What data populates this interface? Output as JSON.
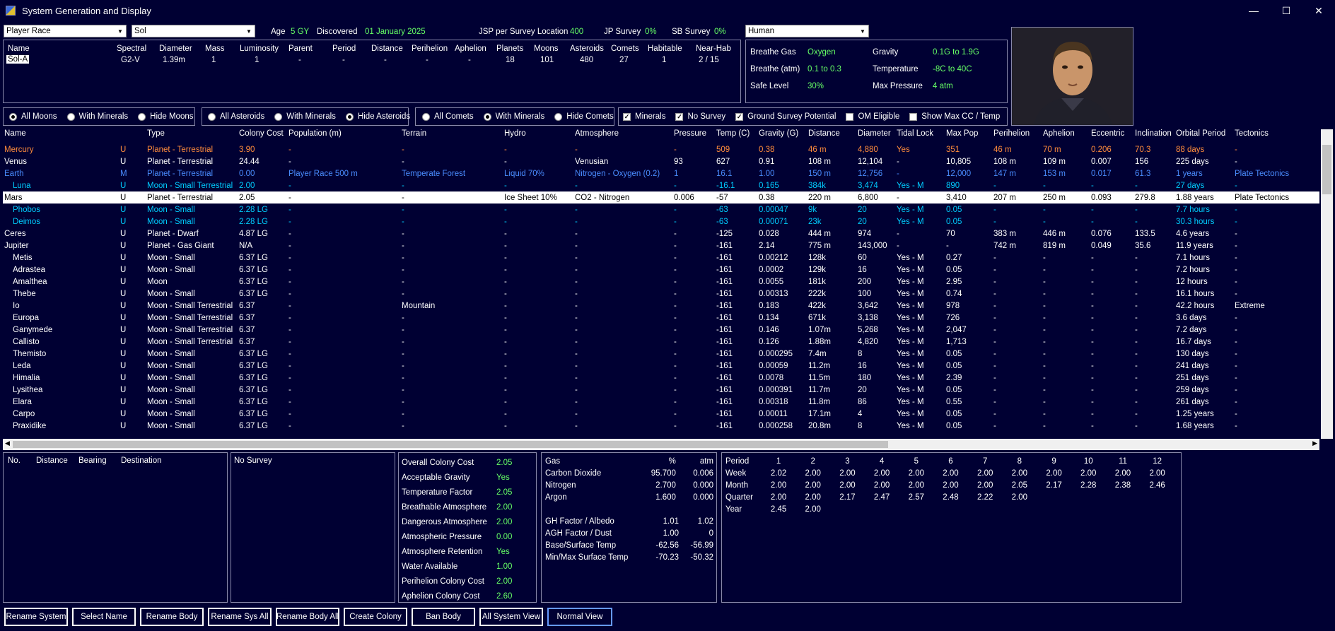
{
  "window": {
    "title": "System Generation and Display",
    "minimize": "—",
    "maximize": "☐",
    "close": "✕"
  },
  "top": {
    "race_combo": "Player Race",
    "system_combo": "Sol",
    "age_label": "Age",
    "age_value": "5 GY",
    "discovered_label": "Discovered",
    "discovered_value": "01 January 2025",
    "jsp_label": "JSP per Survey Location",
    "jsp_value": "400",
    "jp_label": "JP Survey",
    "jp_value": "0%",
    "sb_label": "SB Survey",
    "sb_value": "0%",
    "species_combo": "Human"
  },
  "star_panel": {
    "headers": [
      "Name",
      "Spectral",
      "Diameter",
      "Mass",
      "Luminosity",
      "Parent",
      "Period",
      "Distance",
      "Perihelion",
      "Aphelion",
      "Planets",
      "Moons",
      "Asteroids",
      "Comets",
      "Habitable",
      "Near-Hab"
    ],
    "row": [
      "Sol-A",
      "G2-V",
      "1.39m",
      "1",
      "1",
      "-",
      "-",
      "-",
      "-",
      "-",
      "18",
      "101",
      "480",
      "27",
      "1",
      "2 / 15"
    ]
  },
  "env_panel": {
    "breathe_gas_label": "Breathe Gas",
    "breathe_gas_value": "Oxygen",
    "gravity_label": "Gravity",
    "gravity_value": "0.1G  to  1.9G",
    "breathe_atm_label": "Breathe (atm)",
    "breathe_atm_value": "0.1  to  0.3",
    "temperature_label": "Temperature",
    "temperature_value": "-8C  to  40C",
    "safe_level_label": "Safe Level",
    "safe_level_value": "30%",
    "max_pressure_label": "Max Pressure",
    "max_pressure_value": "4 atm"
  },
  "filters": {
    "moons": {
      "all": "All Moons",
      "minerals": "With Minerals",
      "hide": "Hide Moons"
    },
    "asteroids": {
      "all": "All Asteroids",
      "minerals": "With Minerals",
      "hide": "Hide Asteroids"
    },
    "comets": {
      "all": "All Comets",
      "minerals": "With Minerals",
      "hide": "Hide Comets"
    },
    "checks": {
      "minerals": "Minerals",
      "no_survey": "No Survey",
      "ground_survey": "Ground Survey Potential",
      "om_eligible": "OM Eligible",
      "show_max_cc": "Show Max CC / Temp"
    }
  },
  "grid": {
    "columns": [
      "Name",
      "",
      "Type",
      "Colony Cost",
      "Population (m)",
      "Terrain",
      "Hydro",
      "Atmosphere",
      "Pressure",
      "Temp (C)",
      "Gravity (G)",
      "Distance",
      "Diameter",
      "Tidal Lock",
      "Max Pop",
      "Perihelion",
      "Aphelion",
      "Eccentric",
      "Inclination",
      "Orbital Period",
      "Tectonics"
    ],
    "rows": [
      {
        "c": [
          "Mercury",
          "U",
          "Planet - Terrestrial",
          "3.90",
          "-",
          "-",
          "-",
          "-",
          "-",
          "509",
          "0.38",
          "46 m",
          "4,880",
          "Yes",
          "351",
          "46 m",
          "70 m",
          "0.206",
          "70.3",
          "88 days",
          "-"
        ],
        "color": "#ff8c3c"
      },
      {
        "c": [
          "Venus",
          "U",
          "Planet - Terrestrial",
          "24.44",
          "-",
          "-",
          "-",
          "Venusian",
          "93",
          "627",
          "0.91",
          "108 m",
          "12,104",
          "-",
          "10,805",
          "108 m",
          "109 m",
          "0.007",
          "156",
          "225 days",
          "-"
        ],
        "color": "#ffffff"
      },
      {
        "c": [
          "Earth",
          "M",
          "Planet - Terrestrial",
          "0.00",
          "Player Race 500 m",
          "Temperate Forest",
          "Liquid 70%",
          "Nitrogen - Oxygen (0.2)",
          "1",
          "16.1",
          "1.00",
          "150 m",
          "12,756",
          "-",
          "12,000",
          "147 m",
          "153 m",
          "0.017",
          "61.3",
          "1 years",
          "Plate Tectonics"
        ],
        "color": "#4a8cff"
      },
      {
        "c": [
          "Luna",
          "U",
          "Moon - Small Terrestrial",
          "2.00",
          "-",
          "-",
          "-",
          "-",
          "-",
          "-16.1",
          "0.165",
          "384k",
          "3,474",
          "Yes - M",
          "890",
          "-",
          "-",
          "-",
          "-",
          "27 days",
          "-"
        ],
        "color": "#00ccff",
        "indent": true
      },
      {
        "c": [
          "Mars",
          "U",
          "Planet - Terrestrial",
          "2.05",
          "-",
          "-",
          "Ice Sheet 10%",
          "CO2 - Nitrogen",
          "0.006",
          "-57",
          "0.38",
          "220 m",
          "6,800",
          "-",
          "3,410",
          "207 m",
          "250 m",
          "0.093",
          "279.8",
          "1.88 years",
          "Plate Tectonics"
        ],
        "color": "#000000",
        "selected": true
      },
      {
        "c": [
          "Phobos",
          "U",
          "Moon - Small",
          "2.28 LG",
          "-",
          "-",
          "-",
          "-",
          "-",
          "-63",
          "0.00047",
          "9k",
          "20",
          "Yes - M",
          "0.05",
          "-",
          "-",
          "-",
          "-",
          "7.7 hours",
          "-"
        ],
        "color": "#00ccff",
        "indent": true
      },
      {
        "c": [
          "Deimos",
          "U",
          "Moon - Small",
          "2.28 LG",
          "-",
          "-",
          "-",
          "-",
          "-",
          "-63",
          "0.00071",
          "23k",
          "20",
          "Yes - M",
          "0.05",
          "-",
          "-",
          "-",
          "-",
          "30.3 hours",
          "-"
        ],
        "color": "#00ccff",
        "indent": true
      },
      {
        "c": [
          "Ceres",
          "U",
          "Planet - Dwarf",
          "4.87 LG",
          "-",
          "-",
          "-",
          "-",
          "-",
          "-125",
          "0.028",
          "444 m",
          "974",
          "-",
          "70",
          "383 m",
          "446 m",
          "0.076",
          "133.5",
          "4.6 years",
          "-"
        ],
        "color": "#ffffff"
      },
      {
        "c": [
          "Jupiter",
          "U",
          "Planet - Gas Giant",
          "N/A",
          "-",
          "-",
          "-",
          "-",
          "-",
          "-161",
          "2.14",
          "775 m",
          "143,000",
          "-",
          "-",
          "742 m",
          "819 m",
          "0.049",
          "35.6",
          "11.9 years",
          "-"
        ],
        "color": "#ffffff"
      },
      {
        "c": [
          "Metis",
          "U",
          "Moon - Small",
          "6.37 LG",
          "-",
          "-",
          "-",
          "-",
          "-",
          "-161",
          "0.00212",
          "128k",
          "60",
          "Yes - M",
          "0.27",
          "-",
          "-",
          "-",
          "-",
          "7.1 hours",
          "-"
        ],
        "color": "#ffffff",
        "indent": true
      },
      {
        "c": [
          "Adrastea",
          "U",
          "Moon - Small",
          "6.37 LG",
          "-",
          "-",
          "-",
          "-",
          "-",
          "-161",
          "0.0002",
          "129k",
          "16",
          "Yes - M",
          "0.05",
          "-",
          "-",
          "-",
          "-",
          "7.2 hours",
          "-"
        ],
        "color": "#ffffff",
        "indent": true
      },
      {
        "c": [
          "Amalthea",
          "U",
          "Moon",
          "6.37 LG",
          "-",
          "-",
          "-",
          "-",
          "-",
          "-161",
          "0.0055",
          "181k",
          "200",
          "Yes - M",
          "2.95",
          "-",
          "-",
          "-",
          "-",
          "12 hours",
          "-"
        ],
        "color": "#ffffff",
        "indent": true
      },
      {
        "c": [
          "Thebe",
          "U",
          "Moon - Small",
          "6.37 LG",
          "-",
          "-",
          "-",
          "-",
          "-",
          "-161",
          "0.00313",
          "222k",
          "100",
          "Yes - M",
          "0.74",
          "-",
          "-",
          "-",
          "-",
          "16.1 hours",
          "-"
        ],
        "color": "#ffffff",
        "indent": true
      },
      {
        "c": [
          "Io",
          "U",
          "Moon - Small Terrestrial",
          "6.37",
          "-",
          "Mountain",
          "-",
          "-",
          "-",
          "-161",
          "0.183",
          "422k",
          "3,642",
          "Yes - M",
          "978",
          "-",
          "-",
          "-",
          "-",
          "42.2 hours",
          "Extreme"
        ],
        "color": "#ffffff",
        "indent": true
      },
      {
        "c": [
          "Europa",
          "U",
          "Moon - Small Terrestrial",
          "6.37",
          "-",
          "-",
          "-",
          "-",
          "-",
          "-161",
          "0.134",
          "671k",
          "3,138",
          "Yes - M",
          "726",
          "-",
          "-",
          "-",
          "-",
          "3.6 days",
          "-"
        ],
        "color": "#ffffff",
        "indent": true
      },
      {
        "c": [
          "Ganymede",
          "U",
          "Moon - Small Terrestrial",
          "6.37",
          "-",
          "-",
          "-",
          "-",
          "-",
          "-161",
          "0.146",
          "1.07m",
          "5,268",
          "Yes - M",
          "2,047",
          "-",
          "-",
          "-",
          "-",
          "7.2 days",
          "-"
        ],
        "color": "#ffffff",
        "indent": true
      },
      {
        "c": [
          "Callisto",
          "U",
          "Moon - Small Terrestrial",
          "6.37",
          "-",
          "-",
          "-",
          "-",
          "-",
          "-161",
          "0.126",
          "1.88m",
          "4,820",
          "Yes - M",
          "1,713",
          "-",
          "-",
          "-",
          "-",
          "16.7 days",
          "-"
        ],
        "color": "#ffffff",
        "indent": true
      },
      {
        "c": [
          "Themisto",
          "U",
          "Moon - Small",
          "6.37 LG",
          "-",
          "-",
          "-",
          "-",
          "-",
          "-161",
          "0.000295",
          "7.4m",
          "8",
          "Yes - M",
          "0.05",
          "-",
          "-",
          "-",
          "-",
          "130 days",
          "-"
        ],
        "color": "#ffffff",
        "indent": true
      },
      {
        "c": [
          "Leda",
          "U",
          "Moon - Small",
          "6.37 LG",
          "-",
          "-",
          "-",
          "-",
          "-",
          "-161",
          "0.00059",
          "11.2m",
          "16",
          "Yes - M",
          "0.05",
          "-",
          "-",
          "-",
          "-",
          "241 days",
          "-"
        ],
        "color": "#ffffff",
        "indent": true
      },
      {
        "c": [
          "Himalia",
          "U",
          "Moon - Small",
          "6.37 LG",
          "-",
          "-",
          "-",
          "-",
          "-",
          "-161",
          "0.0078",
          "11.5m",
          "180",
          "Yes - M",
          "2.39",
          "-",
          "-",
          "-",
          "-",
          "251 days",
          "-"
        ],
        "color": "#ffffff",
        "indent": true
      },
      {
        "c": [
          "Lysithea",
          "U",
          "Moon - Small",
          "6.37 LG",
          "-",
          "-",
          "-",
          "-",
          "-",
          "-161",
          "0.000391",
          "11.7m",
          "20",
          "Yes - M",
          "0.05",
          "-",
          "-",
          "-",
          "-",
          "259 days",
          "-"
        ],
        "color": "#ffffff",
        "indent": true
      },
      {
        "c": [
          "Elara",
          "U",
          "Moon - Small",
          "6.37 LG",
          "-",
          "-",
          "-",
          "-",
          "-",
          "-161",
          "0.00318",
          "11.8m",
          "86",
          "Yes - M",
          "0.55",
          "-",
          "-",
          "-",
          "-",
          "261 days",
          "-"
        ],
        "color": "#ffffff",
        "indent": true
      },
      {
        "c": [
          "Carpo",
          "U",
          "Moon - Small",
          "6.37 LG",
          "-",
          "-",
          "-",
          "-",
          "-",
          "-161",
          "0.00011",
          "17.1m",
          "4",
          "Yes - M",
          "0.05",
          "-",
          "-",
          "-",
          "-",
          "1.25 years",
          "-"
        ],
        "color": "#ffffff",
        "indent": true
      },
      {
        "c": [
          "Praxidike",
          "U",
          "Moon - Small",
          "6.37 LG",
          "-",
          "-",
          "-",
          "-",
          "-",
          "-161",
          "0.000258",
          "20.8m",
          "8",
          "Yes - M",
          "0.05",
          "-",
          "-",
          "-",
          "-",
          "1.68 years",
          "-"
        ],
        "color": "#ffffff",
        "indent": true
      }
    ]
  },
  "jump_panel": {
    "headers": [
      "No.",
      "Distance",
      "Bearing",
      "Destination"
    ]
  },
  "survey_panel": {
    "text": "No Survey"
  },
  "colony_panel": {
    "rows": [
      [
        "Overall Colony Cost",
        "2.05"
      ],
      [
        "Acceptable Gravity",
        "Yes"
      ],
      [
        "Temperature Factor",
        "2.05"
      ],
      [
        "Breathable Atmosphere",
        "2.00"
      ],
      [
        "Dangerous Atmosphere",
        "2.00"
      ],
      [
        "Atmospheric Pressure",
        "0.00"
      ],
      [
        "Atmosphere Retention",
        "Yes"
      ],
      [
        "Water Available",
        "1.00"
      ],
      [
        "Perihelion Colony Cost",
        "2.00"
      ],
      [
        "Aphelion Colony Cost",
        "2.60"
      ]
    ]
  },
  "gas_panel": {
    "headers": [
      "Gas",
      "%",
      "atm"
    ],
    "rows": [
      [
        "Carbon Dioxide",
        "95.700",
        "0.006"
      ],
      [
        "Nitrogen",
        "2.700",
        "0.000"
      ],
      [
        "Argon",
        "1.600",
        "0.000"
      ]
    ],
    "factors": [
      [
        "GH Factor / Albedo",
        "1.01",
        "1.02"
      ],
      [
        "AGH Factor / Dust",
        "1.00",
        "0"
      ],
      [
        "Base/Surface Temp",
        "-62.56",
        "-56.99"
      ],
      [
        "Min/Max Surface Temp",
        "-70.23",
        "-50.32"
      ]
    ]
  },
  "period_panel": {
    "headers": [
      "Period",
      "1",
      "2",
      "3",
      "4",
      "5",
      "6",
      "7",
      "8",
      "9",
      "10",
      "11",
      "12"
    ],
    "rows": [
      [
        "Week",
        "2.02",
        "2.00",
        "2.00",
        "2.00",
        "2.00",
        "2.00",
        "2.00",
        "2.00",
        "2.00",
        "2.00",
        "2.00",
        "2.00"
      ],
      [
        "Month",
        "2.00",
        "2.00",
        "2.00",
        "2.00",
        "2.00",
        "2.00",
        "2.00",
        "2.05",
        "2.17",
        "2.28",
        "2.38",
        "2.46"
      ],
      [
        "Quarter",
        "2.00",
        "2.00",
        "2.17",
        "2.47",
        "2.57",
        "2.48",
        "2.22",
        "2.00",
        "",
        "",
        "",
        ""
      ],
      [
        "Year",
        "2.45",
        "2.00",
        "",
        "",
        "",
        "",
        "",
        "",
        "",
        "",
        "",
        ""
      ]
    ]
  },
  "buttons": [
    "Rename System",
    "Select Name",
    "Rename Body",
    "Rename Sys All",
    "Rename Body All",
    "Create Colony",
    "Ban Body",
    "All System View",
    "Normal View"
  ],
  "colors": {
    "bg": "#000033",
    "value_green": "#66ff66",
    "accent_blue": "#6699ff"
  }
}
